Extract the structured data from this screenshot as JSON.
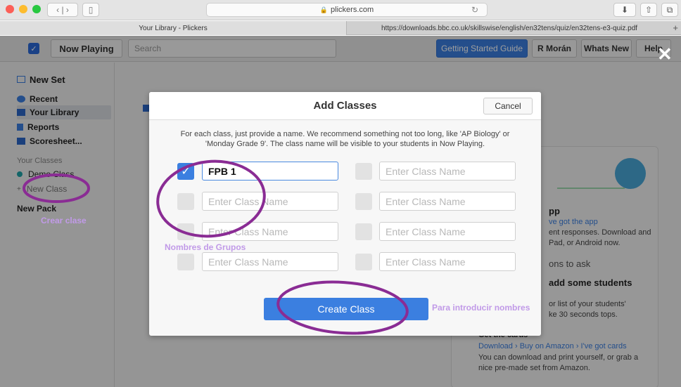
{
  "browser": {
    "address": "plickers.com",
    "tabs": [
      "Your Library - Plickers",
      "https://downloads.bbc.co.uk/skillswise/english/en32tens/quiz/en32tens-e3-quiz.pdf"
    ]
  },
  "header": {
    "now_playing": "Now Playing",
    "search_placeholder": "Search",
    "getting_started": "Getting Started Guide",
    "user": "R Morán",
    "whats_new": "Whats New",
    "help": "Help"
  },
  "sidebar": {
    "new_set": "New Set",
    "recent": "Recent",
    "your_library": "Your Library",
    "reports": "Reports",
    "scoresheet": "Scoresheet...",
    "your_classes_label": "Your Classes",
    "demo_class": "Demo Class",
    "new_class": "New Class",
    "new_pack": "New Pack"
  },
  "side_card": {
    "app_heading": "pp",
    "app_link": "ve got the app",
    "app_text1": "ent responses. Download and",
    "app_text2": "Pad, or Android now.",
    "questions": "ons to ask",
    "students": "add some students",
    "students_text1": "or list of your students'",
    "students_text2": "ke 30 seconds tops.",
    "cards_heading": "Get the cards",
    "cards_link_download": "Download",
    "cards_link_amazon": "Buy on Amazon",
    "cards_link_got": "I've got cards",
    "cards_text1": "You can download and print yourself, or grab a",
    "cards_text2": "nice pre-made set from Amazon."
  },
  "modal": {
    "title": "Add Classes",
    "cancel": "Cancel",
    "desc_line1": "For each class, just provide a name. We recommend something not too long, like 'AP Biology' or",
    "desc_line2": "'Monday Grade 9'. The class name will be visible to your students in Now Playing.",
    "placeholder": "Enter Class Name",
    "first_value": "FPB 1",
    "create": "Create Class"
  },
  "annotations": {
    "crear_clase": "Crear clase",
    "nombres_grupos": "Nombres de Grupos",
    "para_introducir": "Para introducir nombres"
  },
  "colors": {
    "accent": "#3b7fe0",
    "annotation_ring": "#8a2c94",
    "annotation_text": "#c19ae8"
  }
}
